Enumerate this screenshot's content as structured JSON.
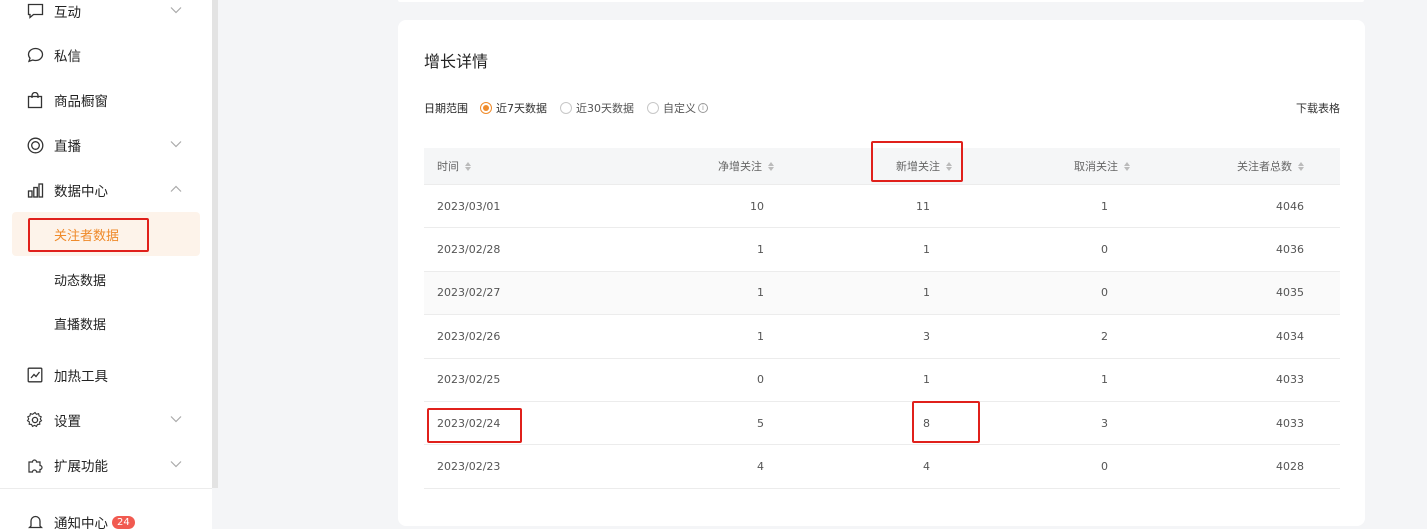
{
  "sidebar": {
    "items": [
      {
        "label": "互动",
        "icon": "chat-bubble-icon",
        "expandable": true
      },
      {
        "label": "私信",
        "icon": "message-icon",
        "expandable": false
      },
      {
        "label": "商品橱窗",
        "icon": "shopping-bag-icon",
        "expandable": false
      },
      {
        "label": "直播",
        "icon": "live-circle-icon",
        "expandable": true
      },
      {
        "label": "数据中心",
        "icon": "bar-chart-icon",
        "expandable": true,
        "expanded": true
      }
    ],
    "sub_items": [
      {
        "label": "关注者数据",
        "active": true
      },
      {
        "label": "动态数据",
        "active": false
      },
      {
        "label": "直播数据",
        "active": false
      }
    ],
    "items_lower": [
      {
        "label": "加热工具",
        "icon": "trend-chart-icon",
        "expandable": false
      },
      {
        "label": "设置",
        "icon": "gear-icon",
        "expandable": true
      },
      {
        "label": "扩展功能",
        "icon": "puzzle-icon",
        "expandable": true
      }
    ],
    "notification": {
      "label": "通知中心",
      "icon": "bell-icon",
      "badge": "24"
    }
  },
  "card": {
    "title": "增长详情",
    "filter_label": "日期范围",
    "options": [
      {
        "label": "近7天数据",
        "checked": true
      },
      {
        "label": "近30天数据",
        "checked": false
      },
      {
        "label": "自定义",
        "checked": false
      }
    ],
    "download_label": "下载表格"
  },
  "table": {
    "headers": [
      "时间",
      "净增关注",
      "新增关注",
      "取消关注",
      "关注者总数"
    ],
    "rows": [
      [
        "2023/03/01",
        "10",
        "11",
        "1",
        "4046"
      ],
      [
        "2023/02/28",
        "1",
        "1",
        "0",
        "4036"
      ],
      [
        "2023/02/27",
        "1",
        "1",
        "0",
        "4035"
      ],
      [
        "2023/02/26",
        "1",
        "3",
        "2",
        "4034"
      ],
      [
        "2023/02/25",
        "0",
        "1",
        "1",
        "4033"
      ],
      [
        "2023/02/24",
        "5",
        "8",
        "3",
        "4033"
      ],
      [
        "2023/02/23",
        "4",
        "4",
        "0",
        "4028"
      ]
    ]
  },
  "colors": {
    "accent": "#f08c2c",
    "highlight": "#e0201b",
    "active_bg": "#fdf3ea"
  }
}
